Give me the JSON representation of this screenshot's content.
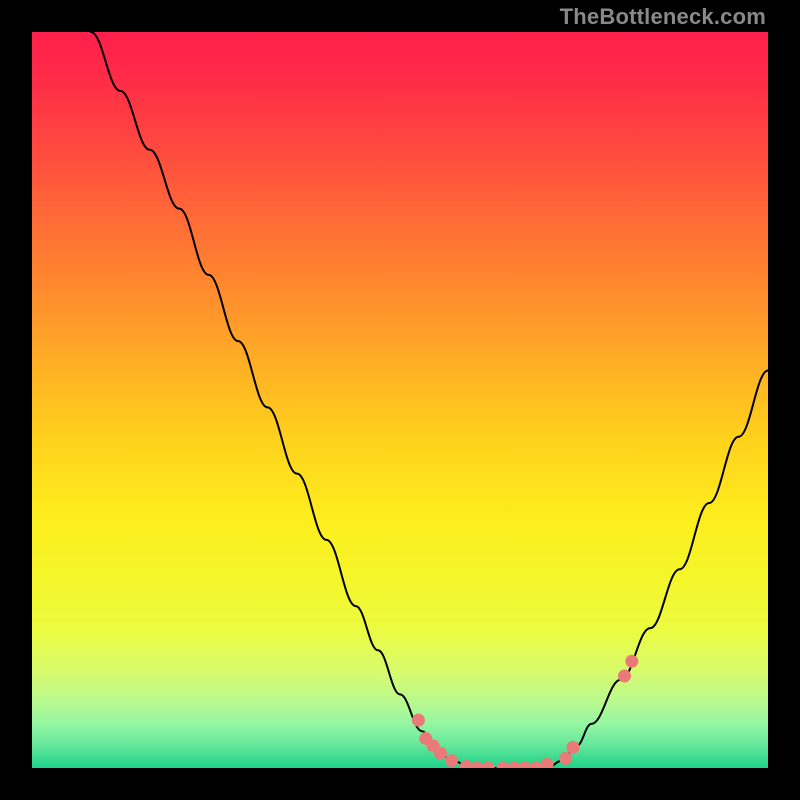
{
  "watermark": "TheBottleneck.com",
  "chart_data": {
    "type": "line",
    "title": "",
    "xlabel": "",
    "ylabel": "",
    "xlim": [
      0,
      100
    ],
    "ylim": [
      0,
      100
    ],
    "series": [
      {
        "name": "curve",
        "x": [
          8,
          12,
          16,
          20,
          24,
          28,
          32,
          36,
          40,
          44,
          47,
          50,
          53,
          55,
          57,
          60,
          65,
          70,
          72,
          74,
          76,
          80,
          84,
          88,
          92,
          96,
          100
        ],
        "y": [
          100,
          92,
          84,
          76,
          67,
          58,
          49,
          40,
          31,
          22,
          16,
          10,
          5,
          2.5,
          1,
          0,
          0,
          0,
          1,
          3,
          6,
          12,
          19,
          27,
          36,
          45,
          54
        ],
        "color": "#000000",
        "stroke_width": 2
      }
    ],
    "scatter": {
      "name": "dots",
      "color": "#e97a77",
      "radius": 6.5,
      "points": [
        {
          "x": 52.5,
          "y": 6.5
        },
        {
          "x": 53.5,
          "y": 4.0
        },
        {
          "x": 54.5,
          "y": 3.0
        },
        {
          "x": 55.5,
          "y": 2.0
        },
        {
          "x": 57.0,
          "y": 1.0
        },
        {
          "x": 59.0,
          "y": 0.2
        },
        {
          "x": 60.5,
          "y": 0.0
        },
        {
          "x": 62.0,
          "y": 0.0
        },
        {
          "x": 64.0,
          "y": 0.0
        },
        {
          "x": 65.5,
          "y": 0.0
        },
        {
          "x": 67.0,
          "y": 0.0
        },
        {
          "x": 68.5,
          "y": 0.0
        },
        {
          "x": 70.0,
          "y": 0.5
        },
        {
          "x": 72.5,
          "y": 1.3
        },
        {
          "x": 73.5,
          "y": 2.8
        },
        {
          "x": 80.5,
          "y": 12.5
        },
        {
          "x": 81.5,
          "y": 14.5
        }
      ]
    }
  }
}
